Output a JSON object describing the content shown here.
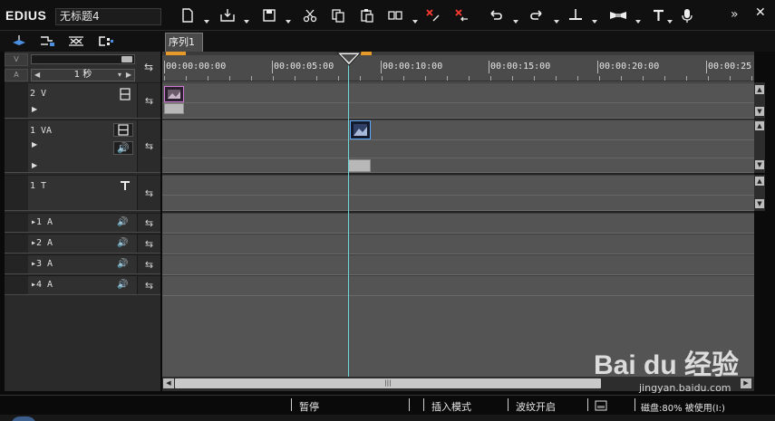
{
  "app": {
    "title": "EDIUS",
    "project_name": "无标题4"
  },
  "toolbar": {
    "buttons": [
      {
        "name": "new-sequence",
        "icon": "new-file-icon"
      },
      {
        "name": "open",
        "icon": "import-icon"
      },
      {
        "name": "save",
        "icon": "save-icon"
      },
      {
        "name": "cut",
        "icon": "scissors-icon"
      },
      {
        "name": "copy",
        "icon": "copy-icon"
      },
      {
        "name": "paste",
        "icon": "paste-icon"
      },
      {
        "name": "replace",
        "icon": "replace-icon"
      },
      {
        "name": "delete",
        "icon": "delete-icon"
      },
      {
        "name": "ripple-delete",
        "icon": "ripple-delete-icon"
      },
      {
        "name": "undo",
        "icon": "undo-icon"
      },
      {
        "name": "redo",
        "icon": "redo-icon"
      },
      {
        "name": "add-edit-point",
        "icon": "add-edit-point-icon"
      },
      {
        "name": "track-mode",
        "icon": "track-mode-icon"
      },
      {
        "name": "title",
        "icon": "title-icon"
      },
      {
        "name": "voice-over",
        "icon": "microphone-icon"
      }
    ],
    "more_glyph": "»",
    "close_glyph": "✕"
  },
  "mode_row": {
    "icons": [
      "sync-lock-icon",
      "track-link-icon",
      "ripple-mode-icon",
      "group-link-icon"
    ]
  },
  "tabs": [
    {
      "label": "序列1",
      "active": true
    }
  ],
  "header": {
    "row_labels": [
      "V",
      "A"
    ],
    "zoom": {
      "value": "1 秒",
      "left_glyph": "◀",
      "right_glyph": "▶",
      "dropdown_glyph": "▾"
    }
  },
  "tracks": [
    {
      "name": "2 V",
      "type": "video"
    },
    {
      "name": "1 VA",
      "type": "video-audio"
    },
    {
      "name": "1 T",
      "type": "title"
    },
    {
      "name": "▸1 A",
      "type": "audio"
    },
    {
      "name": "▸2 A",
      "type": "audio"
    },
    {
      "name": "▸3 A",
      "type": "audio"
    },
    {
      "name": "▸4 A",
      "type": "audio"
    }
  ],
  "ruler": {
    "labels": [
      "00:00:00:00",
      "00:00:05:00",
      "00:00:10:00",
      "00:00:15:00",
      "00:00:20:00",
      "00:00:25"
    ]
  },
  "status": {
    "pause": "暂停",
    "insert_mode": "插入模式",
    "ripple": "波纹开启",
    "disk": "磁盘:80% 被使用(I:)"
  },
  "watermark": {
    "main": "Bai du 经验",
    "sub": "jingyan.baidu.com"
  }
}
